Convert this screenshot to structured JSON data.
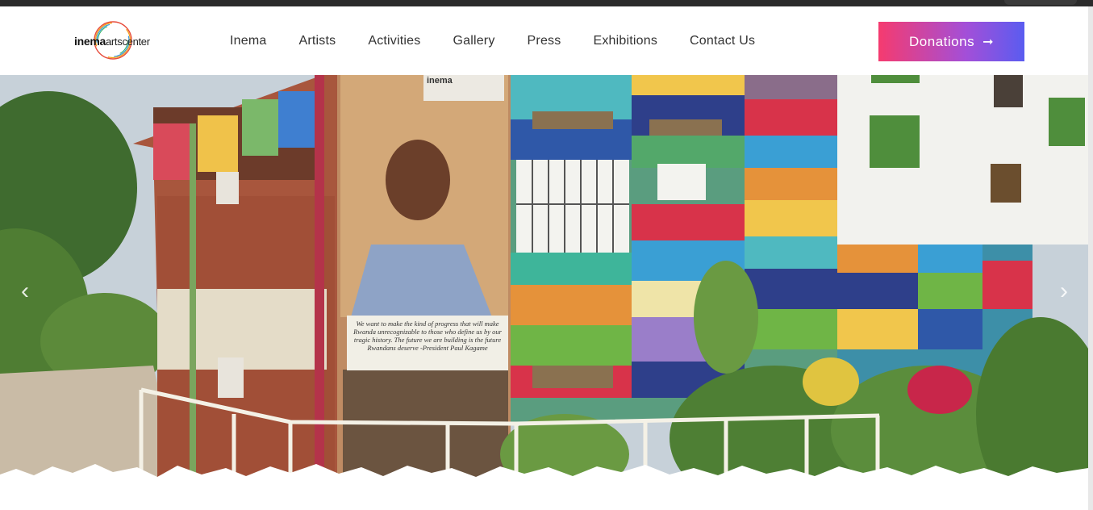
{
  "brand": {
    "logo_bold": "inema",
    "logo_light": "artscenter"
  },
  "nav": {
    "items": [
      "Inema",
      "Artists",
      "Activities",
      "Gallery",
      "Press",
      "Exhibitions",
      "Contact Us"
    ]
  },
  "cta": {
    "label": "Donations",
    "arrow": "➞"
  },
  "hero": {
    "prev_glyph": "‹",
    "next_glyph": "›",
    "mural_sign": "inema",
    "quote": "We want to make the kind of progress that will make Rwanda unrecognizable to those who define us by our tragic history. The future we are building is the future Rwandans deserve -President Paul Kagame"
  },
  "colors": {
    "cta_gradient_start": "#f53b6f",
    "cta_gradient_end": "#5a5cf0",
    "nav_text": "#333333"
  },
  "icons": {
    "carousel_prev": "chevron-left-icon",
    "carousel_next": "chevron-right-icon",
    "cta_arrow": "arrow-right-icon"
  }
}
